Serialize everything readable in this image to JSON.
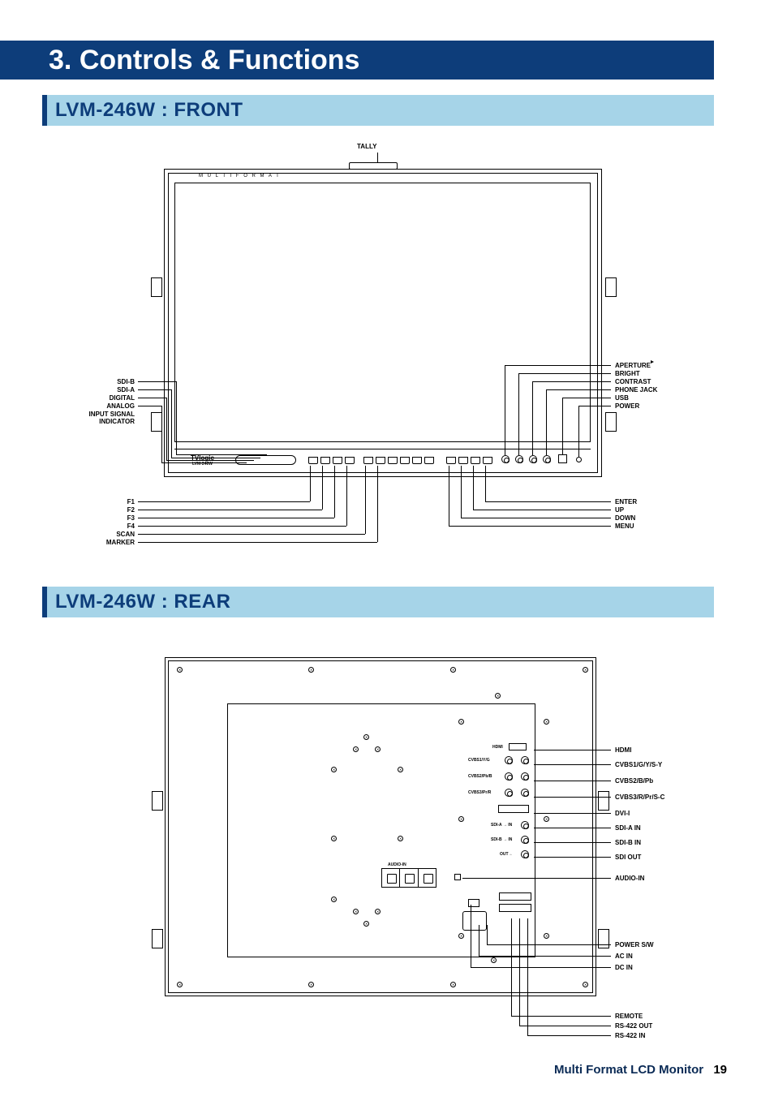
{
  "chapter": {
    "number": "3.",
    "title": "Controls & Functions"
  },
  "sections": {
    "front": "LVM-246W : FRONT",
    "rear": "LVM-246W : REAR"
  },
  "front": {
    "top_label": "TALLY",
    "brand_small": "M U L T I   F O R M A T",
    "logo": "TVlogic",
    "model": "LVM-246W",
    "left_upper": [
      "SDI-B",
      "SDI-A",
      "DIGITAL",
      "ANALOG",
      "INPUT SIGNAL",
      "INDICATOR"
    ],
    "right_upper": [
      "APERTURE",
      "BRIGHT",
      "CONTRAST",
      "PHONE JACK",
      "USB",
      "POWER"
    ],
    "left_lower": [
      "F1",
      "F2",
      "F3",
      "F4",
      "SCAN",
      "MARKER"
    ],
    "right_lower": [
      "ENTER",
      "UP",
      "DOWN",
      "MENU"
    ]
  },
  "rear": {
    "right": [
      "HDMI",
      "CVBS1/G/Y/S-Y",
      "CVBS2/B/Pb",
      "CVBS3/R/Pr/S-C",
      "DVI-I",
      "SDI-A IN",
      "SDI-B IN",
      "SDI OUT",
      "AUDIO-IN",
      "POWER S/W",
      "AC IN",
      "DC IN",
      "REMOTE",
      "RS-422 OUT",
      "RS-422 IN"
    ],
    "audio_in_label": "AUDIO-IN"
  },
  "footer": {
    "title": "Multi Format LCD Monitor",
    "page": "19"
  }
}
